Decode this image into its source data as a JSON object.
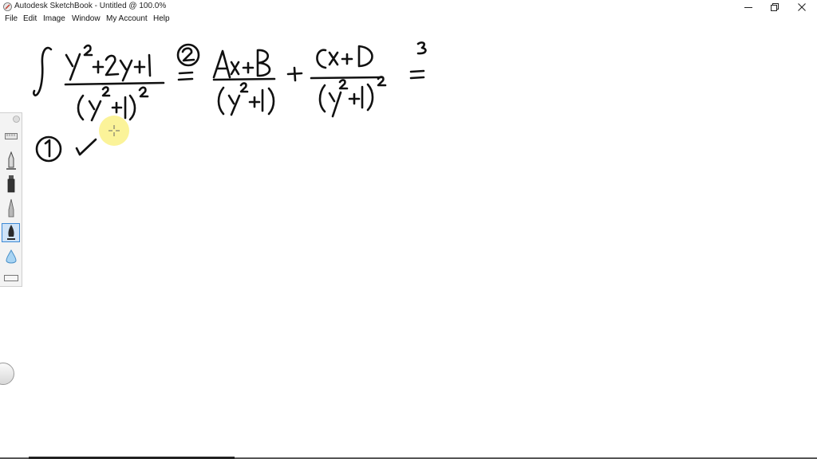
{
  "window": {
    "title": "Autodesk SketchBook - Untitled @ 100.0%"
  },
  "menu": {
    "items": [
      {
        "label": "File"
      },
      {
        "label": "Edit"
      },
      {
        "label": "Image"
      },
      {
        "label": "Window"
      },
      {
        "label": "My Account"
      },
      {
        "label": "Help"
      }
    ]
  },
  "toolbar": {
    "tools": [
      {
        "icon": "ruler-icon"
      },
      {
        "icon": "pencil-icon"
      },
      {
        "icon": "marker-icon"
      },
      {
        "icon": "airbrush-icon"
      },
      {
        "icon": "ink-pen-icon",
        "selected": true
      },
      {
        "icon": "water-drop-icon"
      },
      {
        "icon": "eraser-icon"
      }
    ]
  },
  "colors": {
    "ink": "#111111",
    "selection": "#3d8ad6",
    "cursor_halo": "#fbf28f"
  }
}
